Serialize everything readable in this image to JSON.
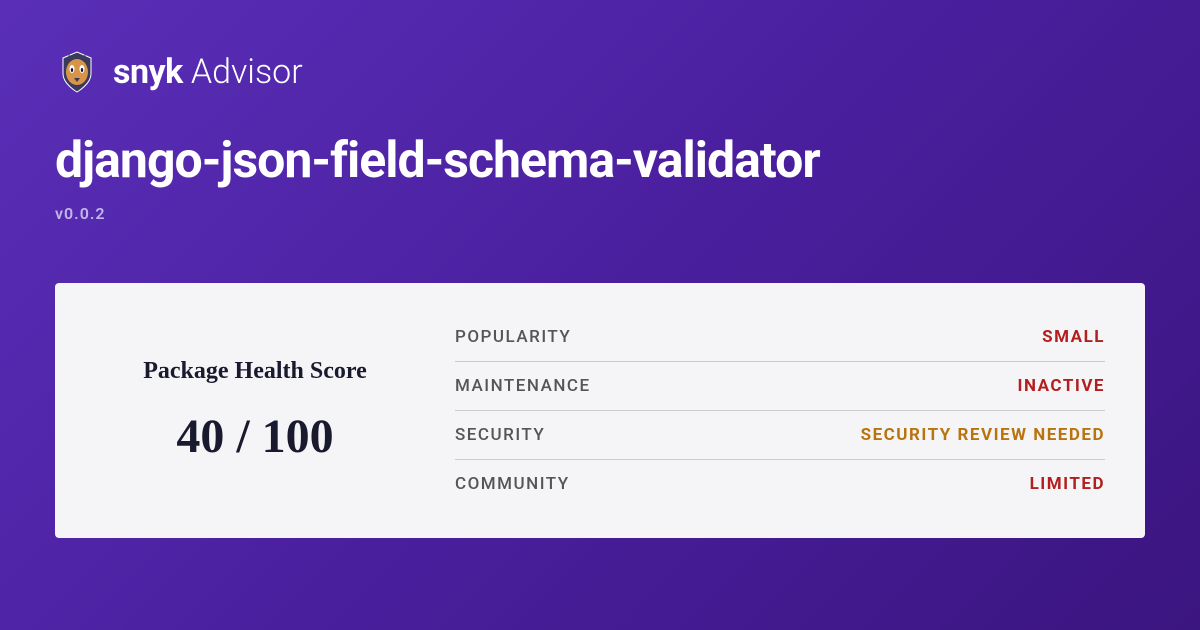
{
  "brand": {
    "name": "snyk",
    "sub": "Advisor"
  },
  "package": {
    "title": "django-json-field-schema-validator",
    "version": "v0.0.2"
  },
  "score": {
    "label": "Package Health Score",
    "value": "40 / 100"
  },
  "metrics": [
    {
      "label": "POPULARITY",
      "value": "SMALL",
      "color": "red"
    },
    {
      "label": "MAINTENANCE",
      "value": "INACTIVE",
      "color": "red"
    },
    {
      "label": "SECURITY",
      "value": "SECURITY REVIEW NEEDED",
      "color": "orange"
    },
    {
      "label": "COMMUNITY",
      "value": "LIMITED",
      "color": "red"
    }
  ]
}
